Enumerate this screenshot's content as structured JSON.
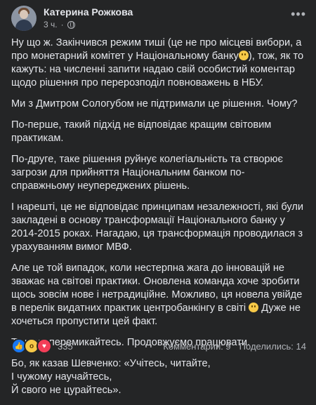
{
  "author": {
    "name": "Катерина Рожкова",
    "time": "3 ч.",
    "dot": "·"
  },
  "post": {
    "paragraphs": [
      "Ну що ж. Закінчився режим тиші (це не про місцеві вибори, а про монетарний комітет у Національному банку",
      "Ми з Дмитром Сологубом не підтримали це рішення. Чому?",
      "По-перше, такий підхід не відповідає кращим світовим практикам.",
      "По-друге, таке рішення руйнує колегіальність та створює загрози для прийняття Національним банком по-справжньому неупереджених рішень.",
      "І нарешті, це не відповідає принципам незалежності, які були закладені в основу трансформації Національного банку у 2014-2015 роках. Нагадаю, ця трансформація проводилася з урахуванням вимог МВФ.",
      "Але це той випадок, коли нестерпна жага до інновацій не зважає на світові практики. Оновлена команда хоче зробити щось зовсім нове і нетрадиційне. Можливо, ця новела увійде в перелік видатних практик центробанкінгу в світі",
      "Тож, не перемикайтесь. Продовжуємо працювати.",
      "Бо, як казав Шевченко: «Учітесь, читайте,\nІ чужому научайтесь,\nЙ свого не цурайтесь»."
    ],
    "p1_tail": "), тож, як то кажуть: на численні запити надаю свій особистий коментар щодо рішення про перерозподіл повноважень в НБУ.",
    "p6_tail": " Дуже не хочеться пропустити цей факт."
  },
  "footer": {
    "reaction_count": "335",
    "comments": "Комментарии: 9",
    "shares": "Поделились: 14",
    "reaction_icons": [
      "like-icon",
      "wow-icon",
      "love-icon"
    ]
  },
  "colors": {
    "background": "#242526",
    "text": "#e4e6eb",
    "muted": "#b0b3b8",
    "like": "#1877f2"
  }
}
